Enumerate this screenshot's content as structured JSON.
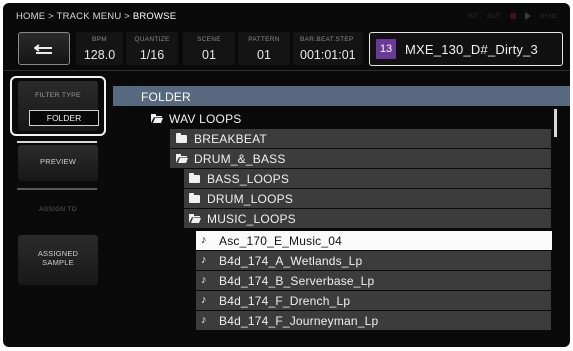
{
  "breadcrumb": {
    "path": [
      "HOME",
      "TRACK MENU"
    ],
    "separator": " > ",
    "current": "BROWSE"
  },
  "status": {
    "items": [
      "INT",
      "OUT",
      "SYNC"
    ]
  },
  "header": {
    "bpm": {
      "label": "BPM",
      "value": "128.0"
    },
    "quantize": {
      "label": "QUANTIZE",
      "value": "1/16"
    },
    "scene": {
      "label": "SCENE",
      "value": "01"
    },
    "pattern": {
      "label": "PATTERN",
      "value": "01"
    },
    "bar_beat_step": {
      "label": "BAR.BEAT.STEP",
      "value": "001:01:01"
    },
    "sample": {
      "number": "13",
      "name": "MXE_130_D#_Dirty_3"
    }
  },
  "left": {
    "filter_type_label": "FILTER TYPE",
    "filter_type_value": "FOLDER",
    "preview_label": "PREVIEW",
    "assign_to_label": "ASSIGN TO",
    "assigned_sample_label": "ASSIGNED SAMPLE"
  },
  "browser": {
    "header": "FOLDER",
    "rows": [
      {
        "label": "WAV LOOPS",
        "icon": "folder-open-icon"
      },
      {
        "label": "BREAKBEAT",
        "icon": "folder-icon"
      },
      {
        "label": "DRUM_&_BASS",
        "icon": "folder-open-icon"
      },
      {
        "label": "BASS_LOOPS",
        "icon": "folder-icon"
      },
      {
        "label": "DRUM_LOOPS",
        "icon": "folder-icon"
      },
      {
        "label": "MUSIC_LOOPS",
        "icon": "folder-open-icon"
      },
      {
        "label": "Asc_170_E_Music_04",
        "icon": "music-note-icon",
        "selected": true
      },
      {
        "label": "B4d_174_A_Wetlands_Lp",
        "icon": "music-note-icon"
      },
      {
        "label": "B4d_174_B_Serverbase_Lp",
        "icon": "music-note-icon"
      },
      {
        "label": "B4d_174_F_Drench_Lp",
        "icon": "music-note-icon"
      },
      {
        "label": "B4d_174_F_Journeyman_Lp",
        "icon": "music-note-icon"
      }
    ]
  },
  "colors": {
    "header_bar": "#56697e",
    "sample_badge": "#6a3a9a",
    "selected_row": "#fafafa",
    "row_bg": "#3c3c3c"
  }
}
